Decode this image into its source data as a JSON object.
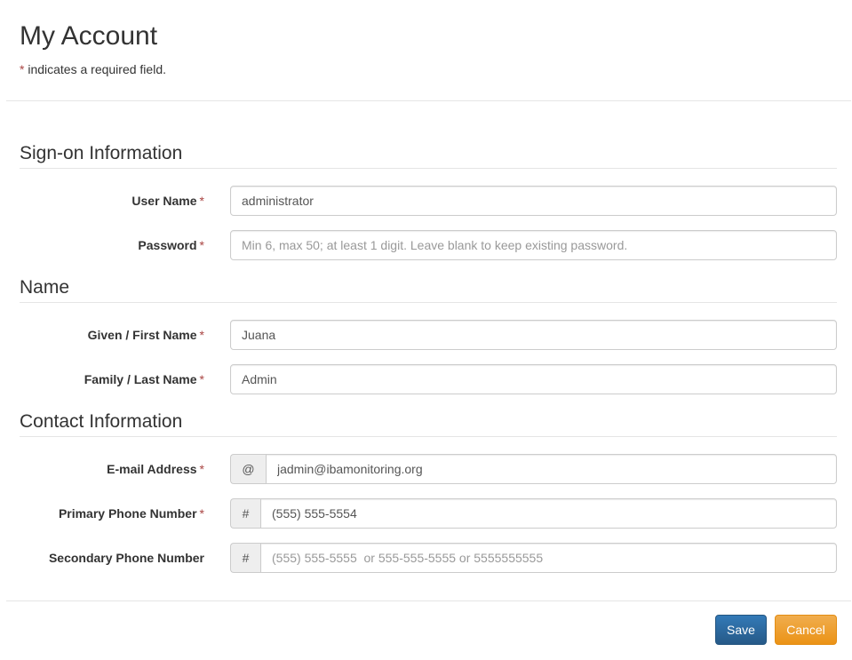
{
  "header": {
    "title": "My Account",
    "required_star": "*",
    "required_note": " indicates a required field."
  },
  "sections": {
    "signon": "Sign-on Information",
    "name": "Name",
    "contact": "Contact Information"
  },
  "fields": {
    "username": {
      "label": "User Name",
      "value": "administrator",
      "required": "*"
    },
    "password": {
      "label": "Password",
      "placeholder": "Min 6, max 50; at least 1 digit. Leave blank to keep existing password.",
      "required": "*"
    },
    "first_name": {
      "label": "Given / First Name",
      "value": "Juana",
      "required": "*"
    },
    "last_name": {
      "label": "Family / Last Name",
      "value": "Admin",
      "required": "*"
    },
    "email": {
      "label": "E-mail Address",
      "addon": "@",
      "value": "jadmin@ibamonitoring.org",
      "required": "*"
    },
    "primary_phone": {
      "label": "Primary Phone Number",
      "addon": "#",
      "value": "(555) 555-5554",
      "required": "*"
    },
    "secondary_phone": {
      "label": "Secondary Phone Number",
      "addon": "#",
      "placeholder": "(555) 555-5555  or 555-555-5555 or 5555555555"
    }
  },
  "buttons": {
    "save": "Save",
    "cancel": "Cancel"
  },
  "colors": {
    "required": "#a94442",
    "primary": "#337ab7",
    "warning": "#f0ad4e"
  }
}
